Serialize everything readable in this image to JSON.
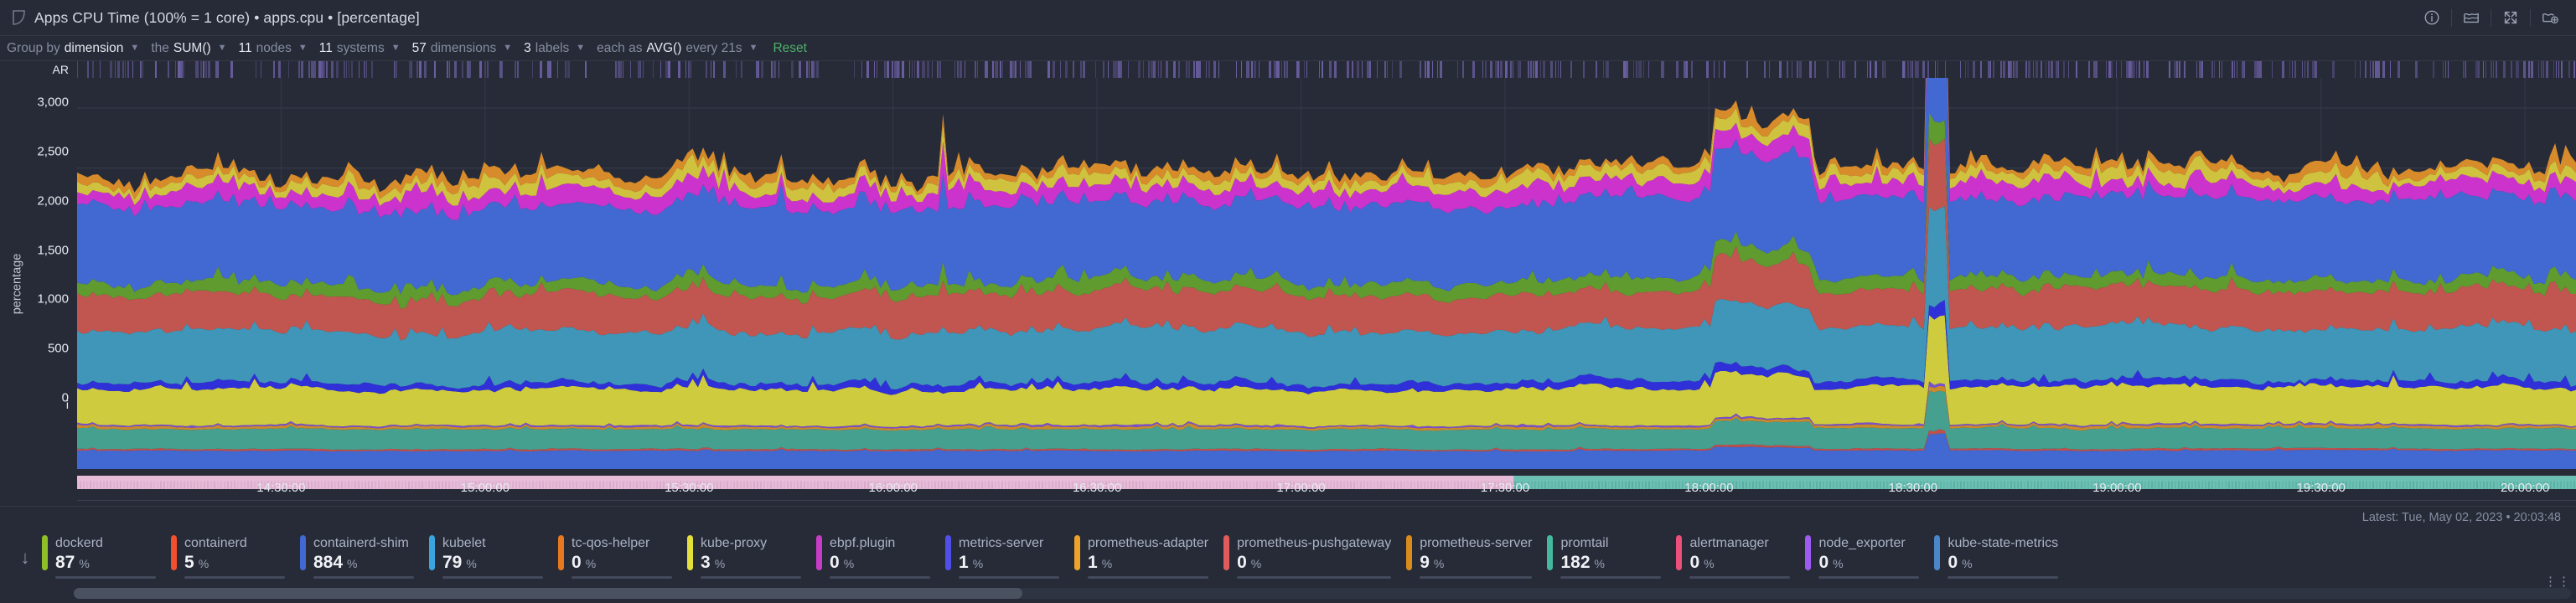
{
  "header": {
    "title": "Apps CPU Time (100% = 1 core) • apps.cpu • [percentage]",
    "icons": [
      "netdata-logo-icon",
      "info-icon",
      "area-chart-icon",
      "fullscreen-icon",
      "add-to-dashboard-icon"
    ]
  },
  "toolbar": {
    "groups": [
      {
        "name": "group-by",
        "pre": "Group by",
        "value": "dimension",
        "post": "",
        "caret": true
      },
      {
        "name": "aggregate",
        "pre": "the",
        "value": "SUM()",
        "post": "",
        "caret": true
      },
      {
        "name": "nodes",
        "pre": "",
        "value": "11",
        "post": "nodes",
        "caret": true
      },
      {
        "name": "systems",
        "pre": "",
        "value": "11",
        "post": "systems",
        "caret": true
      },
      {
        "name": "dimensions",
        "pre": "",
        "value": "57",
        "post": "dimensions",
        "caret": true
      },
      {
        "name": "labels",
        "pre": "",
        "value": "3",
        "post": "labels",
        "caret": true
      },
      {
        "name": "time-agg",
        "pre": "each as",
        "value": "AVG()",
        "post": "every 21s",
        "caret": true
      }
    ],
    "reset_label": "Reset"
  },
  "chart_data": {
    "type": "area",
    "stacked": true,
    "title": "Apps CPU Time (100% = 1 core)",
    "context": "apps.cpu",
    "xlabel": "",
    "ylabel": "percentage",
    "ylim": [
      0,
      3250
    ],
    "yticks": [
      0,
      500,
      1000,
      1500,
      2000,
      2500,
      3000
    ],
    "ytick_labels": [
      "0",
      "500",
      "1,000",
      "1,500",
      "2,000",
      "2,500",
      "3,000"
    ],
    "grid": true,
    "legend_position": "bottom",
    "xticks": [
      "14:30:00",
      "15:00:00",
      "15:30:00",
      "16:00:00",
      "16:30:00",
      "17:00:00",
      "17:30:00",
      "18:00:00",
      "18:30:00",
      "19:00:00",
      "19:30:00",
      "20:00:00"
    ],
    "x_range": [
      "14:10:00",
      "20:05:00"
    ],
    "annotation_rows": [
      {
        "label": "AR",
        "name": "anomaly-rate-row",
        "color": "#6f62a8"
      },
      {
        "label": "i",
        "name": "info-row",
        "colors": [
          "#e6bcd8",
          "#6cc0b4"
        ],
        "split": 0.575
      }
    ],
    "latest": "Latest: Tue, May 02, 2023 • 20:03:48",
    "series": [
      {
        "name": "dockerd",
        "color": "#8fbf28",
        "value": 87,
        "unit": "%",
        "base": 33,
        "amp": 7,
        "seed": 11
      },
      {
        "name": "containerd",
        "color": "#f1502f",
        "value": 5,
        "unit": "%",
        "base": 10,
        "amp": 3,
        "seed": 23
      },
      {
        "name": "containerd-shim",
        "color": "#4169d1",
        "value": 884,
        "unit": "%",
        "base": 300,
        "amp": 22,
        "seed": 31
      },
      {
        "name": "kubelet",
        "color": "#3ba3dd",
        "value": 79,
        "unit": "%",
        "base": 38,
        "amp": 9,
        "seed": 43
      },
      {
        "name": "tc-qos-helper",
        "color": "#e87820",
        "value": 0,
        "unit": "%",
        "base": 9,
        "amp": 4,
        "seed": 57
      },
      {
        "name": "kube-proxy",
        "color": "#e3e03c",
        "value": 3,
        "unit": "%",
        "base": 14,
        "amp": 4,
        "seed": 61
      },
      {
        "name": "ebpf.plugin",
        "color": "#c63cc6",
        "value": 0,
        "unit": "%",
        "base": 12,
        "amp": 4,
        "seed": 73
      },
      {
        "name": "metrics-server",
        "color": "#5050e8",
        "value": 1,
        "unit": "%",
        "base": 11,
        "amp": 4,
        "seed": 83
      },
      {
        "name": "prometheus-adapter",
        "color": "#eda229",
        "value": 1,
        "unit": "%",
        "base": 10,
        "amp": 3,
        "seed": 97
      },
      {
        "name": "prometheus-pushgateway",
        "color": "#e05c5c",
        "value": 0,
        "unit": "%",
        "base": 9,
        "amp": 3,
        "seed": 101
      },
      {
        "name": "prometheus-server",
        "color": "#d98c1c",
        "value": 9,
        "unit": "%",
        "base": 13,
        "amp": 5,
        "seed": 109
      },
      {
        "name": "promtail",
        "color": "#45b8a0",
        "value": 182,
        "unit": "%",
        "base": 120,
        "amp": 10,
        "seed": 127
      },
      {
        "name": "alertmanager",
        "color": "#ec4f79",
        "value": 0,
        "unit": "%",
        "base": 8,
        "amp": 3,
        "seed": 131
      },
      {
        "name": "node_exporter",
        "color": "#9d5bf0",
        "value": 0,
        "unit": "%",
        "base": 9,
        "amp": 3,
        "seed": 139
      },
      {
        "name": "kube-state-metrics",
        "color": "#4a86c8",
        "value": 0,
        "unit": "%",
        "base": 140,
        "amp": 8,
        "seed": 149
      }
    ],
    "stack_layers": [
      {
        "name": "kube-state-metrics",
        "color": "#4169d1",
        "base": 150,
        "amp": 6,
        "seed": 5
      },
      {
        "name": "alertmanager",
        "color": "#c0504a",
        "base": 14,
        "amp": 3,
        "seed": 17
      },
      {
        "name": "promtail",
        "color": "#45a08f",
        "base": 165,
        "amp": 10,
        "seed": 29
      },
      {
        "name": "prometheus-server",
        "color": "#c98a2c",
        "base": 20,
        "amp": 6,
        "seed": 37
      },
      {
        "name": "metrics-server",
        "color": "#7b4fd0",
        "base": 12,
        "amp": 4,
        "seed": 41
      },
      {
        "name": "kube-proxy",
        "color": "#cfcb3e",
        "base": 300,
        "amp": 30,
        "seed": 53
      },
      {
        "name": "ebpf.plugin",
        "color": "#3030d8",
        "base": 55,
        "amp": 24,
        "seed": 59
      },
      {
        "name": "kubelet",
        "color": "#3f96b8",
        "base": 430,
        "amp": 30,
        "seed": 67
      },
      {
        "name": "containerd",
        "color": "#c0564f",
        "base": 300,
        "amp": 34,
        "seed": 79
      },
      {
        "name": "dockerd",
        "color": "#5f9b2f",
        "base": 100,
        "amp": 32,
        "seed": 89
      },
      {
        "name": "containerd-shim",
        "color": "#4169d1",
        "base": 640,
        "amp": 40,
        "seed": 103
      },
      {
        "name": "node_exporter",
        "color": "#cc33cc",
        "base": 115,
        "amp": 45,
        "seed": 113
      },
      {
        "name": "prometheus-adapter",
        "color": "#cfc23e",
        "base": 75,
        "amp": 35,
        "seed": 151
      },
      {
        "name": "tc-qos-helper",
        "color": "#d78b2a",
        "base": 60,
        "amp": 30,
        "seed": 163
      }
    ]
  },
  "legend": {
    "sort_icon": "sort-descending-arrow-icon",
    "more_icon": "more-options-icon",
    "unit": "%"
  },
  "scrollbar": {
    "name": "horizontal-scrollbar",
    "thumb_start_pct": 0,
    "thumb_width_pct": 38
  }
}
